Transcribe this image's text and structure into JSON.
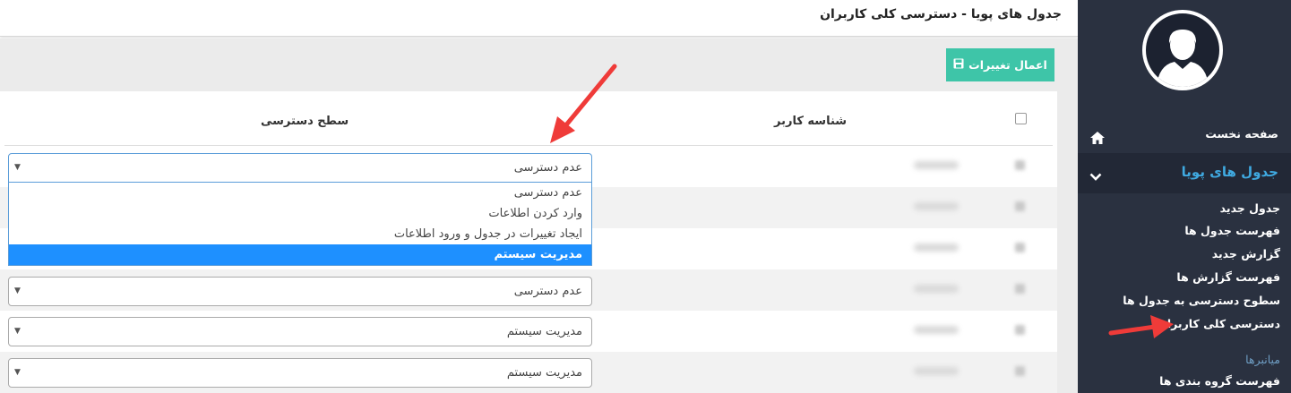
{
  "header": {
    "title": "جدول های پویا - دسترسی کلی کاربران"
  },
  "toolbar": {
    "save_label": "اعمال تغییرات",
    "save_icon": "floppy-disk-icon"
  },
  "table": {
    "col_user": "شناسه کاربر",
    "col_access": "سطح دسترسی",
    "rows": [
      {
        "access": "عدم دسترسی"
      },
      {
        "access": "عدم دسترسی"
      },
      {
        "access": "مدیریت سیستم"
      },
      {
        "access": "مدیریت سیستم"
      }
    ]
  },
  "dropdown": {
    "options": [
      "عدم دسترسی",
      "وارد کردن اطلاعات",
      "ایجاد تغییرات در جدول و ورود اطلاعات",
      "مدیریت سیستم"
    ],
    "highlighted": "مدیریت سیستم"
  },
  "sidebar": {
    "home_label": "صفحه نخست",
    "section_label": "جدول های پویا",
    "items": [
      {
        "label": "جدول جدید"
      },
      {
        "label": "فهرست جدول ها"
      },
      {
        "label": "گزارش جدید"
      },
      {
        "label": "فهرست گزارش ها"
      },
      {
        "label": "سطوح دسترسی به جدول ها"
      },
      {
        "label": "دسترسی کلی کاربران"
      }
    ],
    "shortcuts_label": "میانبرها",
    "shortcut_items": [
      {
        "label": "فهرست گروه بندی ها"
      }
    ]
  },
  "colors": {
    "accent": "#3ec5a8",
    "sidebar_bg": "#2a3140",
    "active_link": "#3fa9e0",
    "highlight": "#1e90ff",
    "annotation": "#ef3b39"
  }
}
